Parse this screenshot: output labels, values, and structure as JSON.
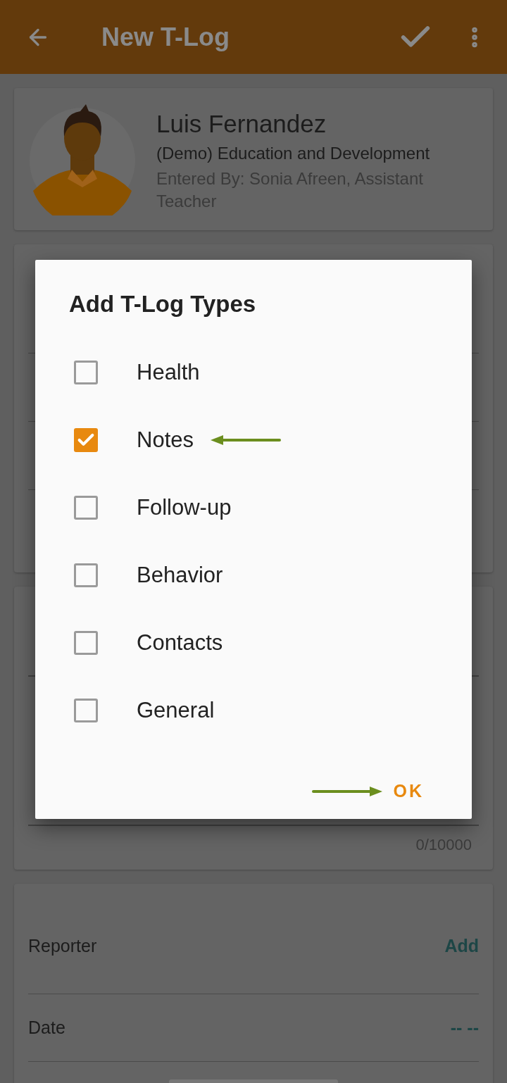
{
  "app_bar": {
    "title": "New T-Log"
  },
  "student": {
    "name": "Luis Fernandez",
    "program": "(Demo) Education and Development",
    "entered_by": "Entered By: Sonia Afreen, Assistant Teacher"
  },
  "notes": {
    "counter": "0/10000"
  },
  "people_rows": [
    {
      "label": "Reporter",
      "value": "Add"
    },
    {
      "label": "Date",
      "value": "-- --"
    }
  ],
  "dialog": {
    "title": "Add T-Log Types",
    "options": [
      {
        "label": "Health",
        "checked": false,
        "annotated": false
      },
      {
        "label": "Notes",
        "checked": true,
        "annotated": true
      },
      {
        "label": "Follow-up",
        "checked": false,
        "annotated": false
      },
      {
        "label": "Behavior",
        "checked": false,
        "annotated": false
      },
      {
        "label": "Contacts",
        "checked": false,
        "annotated": false
      },
      {
        "label": "General",
        "checked": false,
        "annotated": false
      }
    ],
    "ok": {
      "label": "OK",
      "annotated": true
    }
  }
}
